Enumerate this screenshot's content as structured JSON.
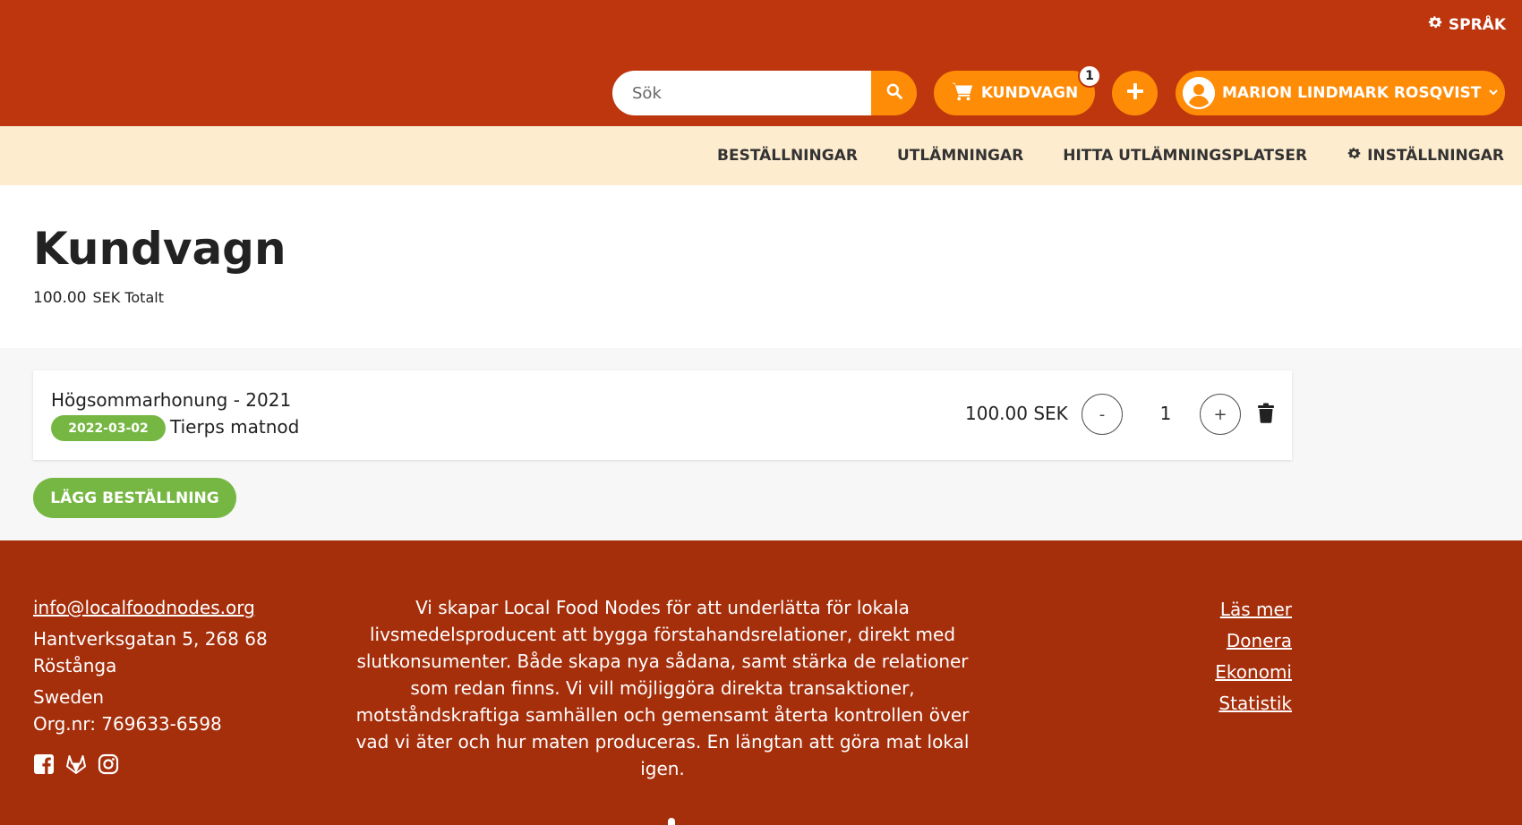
{
  "header": {
    "language_label": "SPRÅK",
    "search_placeholder": "Sök",
    "search_value": "",
    "cart_label": "KUNDVAGN",
    "cart_count": "1",
    "user_name": "MARION LINDMARK ROSQVIST",
    "brand_color": "#bd360d",
    "accent_color": "#fe8c07"
  },
  "nav": {
    "items": [
      {
        "label": "BESTÄLLNINGAR"
      },
      {
        "label": "UTLÄMNINGAR"
      },
      {
        "label": "HITTA UTLÄMNINGSPLATSER"
      },
      {
        "label": "INSTÄLLNINGAR",
        "icon": "gear-icon"
      }
    ],
    "background": "#feeccf"
  },
  "page": {
    "title": "Kundvagn",
    "total_amount": "100.00",
    "total_label": "SEK Totalt"
  },
  "cart": {
    "items": [
      {
        "product": "Högsommarhonung - 2021",
        "date": "2022-03-02",
        "node": "Tierps matnod",
        "price": "100.00 SEK",
        "quantity": "1",
        "minus_label": "-",
        "plus_label": "+"
      }
    ],
    "order_button": "LÄGG BESTÄLLNING",
    "green_color": "#76b743"
  },
  "footer": {
    "email": "info@localfoodnodes.org",
    "address_line1": "Hantverksgatan 5, 268 68",
    "address_line2": "Röstånga",
    "country": "Sweden",
    "org_nr": "Org.nr: 769633-6598",
    "about": "Vi skapar Local Food Nodes för att underlätta för lokala livsmedelsproducent att bygga förstahandsrelationer, direkt med slutkonsumenter. Både skapa nya sådana, samt stärka de relationer som redan finns. Vi vill möjliggöra direkta transaktioner, motståndskraftiga samhällen och gemensamt återta kontrollen över vad vi äter och hur maten produceras. En längtan att göra mat lokal igen.",
    "links": [
      "Läs mer",
      "Donera",
      "Ekonomi",
      "Statistik"
    ],
    "socials": [
      "facebook-icon",
      "gitlab-icon",
      "instagram-icon"
    ],
    "background": "#a52e0b"
  }
}
